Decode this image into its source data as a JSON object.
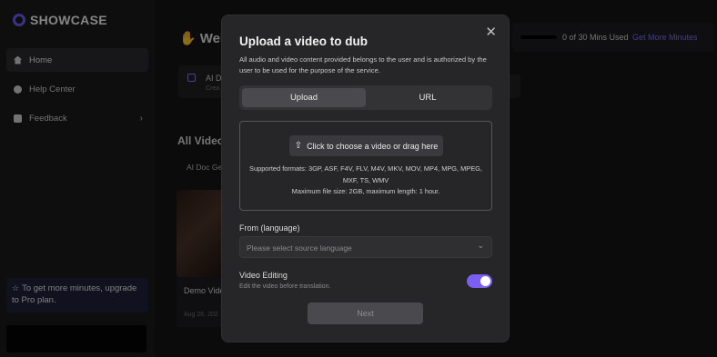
{
  "app": {
    "brand": "SHOWCASE"
  },
  "sidebar": {
    "items": [
      {
        "label": "Home",
        "icon": "home-icon"
      },
      {
        "label": "Help Center",
        "icon": "help-icon"
      },
      {
        "label": "Feedback",
        "icon": "feedback-icon"
      }
    ],
    "upgrade_text": "To get more minutes, upgrade to Pro plan."
  },
  "main": {
    "welcome": "Wel",
    "card_title": "AI D",
    "card_sub": "Crea",
    "all_videos": "All Video",
    "tab_label": "AI Doc Ge",
    "video_name": "Demo Vide",
    "video_date": "Aug 26, 202"
  },
  "usage": {
    "text": "0 of 30 Mins Used",
    "link": "Get More Minutes",
    "used_fraction": 0
  },
  "modal": {
    "title": "Upload a video to dub",
    "description": "All audio and video content provided belongs to the user and is authorized by the user to be used for the purpose of the service.",
    "tabs": [
      "Upload",
      "URL"
    ],
    "active_tab": "Upload",
    "choose_button": "Click to choose a video or drag here",
    "formats": "Supported formats: 3GP, ASF, F4V, FLV, M4V, MKV, MOV, MP4, MPG, MPEG, MXF, TS, WMV",
    "max_size": "Maximum file size: 2GB, maximum length: 1 hour.",
    "from_label": "From (language)",
    "from_placeholder": "Please select source language",
    "video_editing_label": "Video Editing",
    "video_editing_sub": "Edit the video before translation.",
    "video_editing_on": true,
    "next_button": "Next"
  },
  "colors": {
    "accent": "#7b5ff0",
    "link": "#7a6cf5",
    "modal_bg": "#262628",
    "page_bg": "#141416"
  }
}
